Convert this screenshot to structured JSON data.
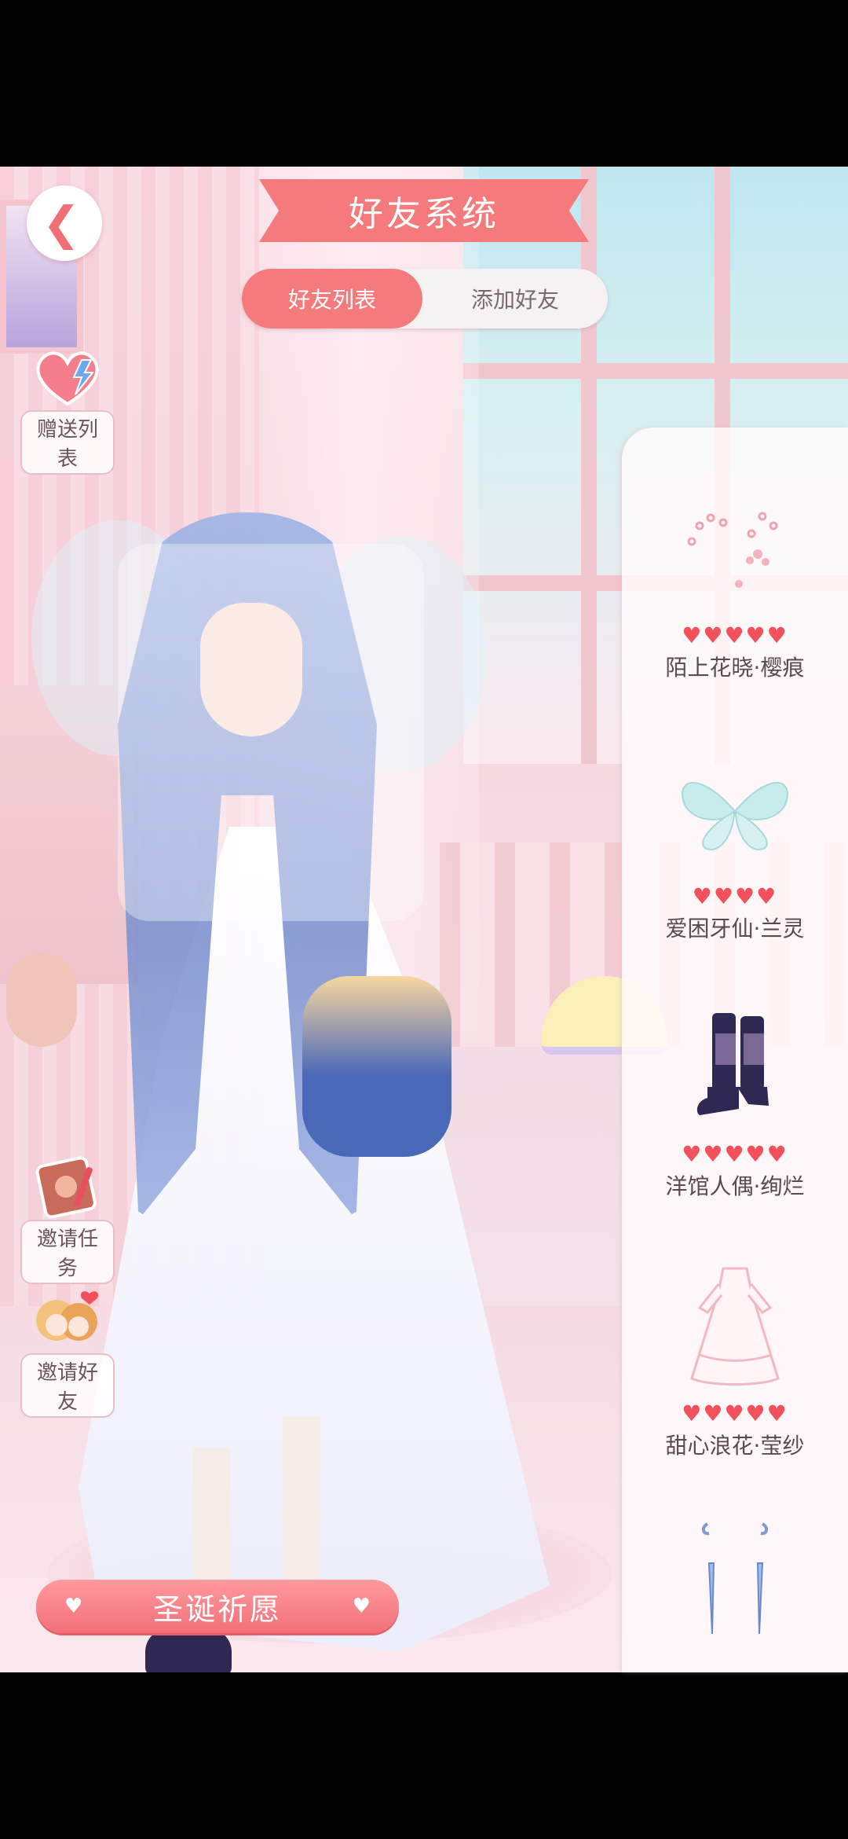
{
  "header": {
    "title": "好友系统",
    "back_icon": "chevron-left-icon"
  },
  "tabs": [
    {
      "label": "好友列表",
      "active": true
    },
    {
      "label": "添加好友",
      "active": false
    }
  ],
  "side_buttons": {
    "gift_list": {
      "label": "赠送列表",
      "icon": "heart-lightning-icon"
    },
    "invite_task": {
      "label": "邀请任务",
      "icon": "notebook-icon"
    },
    "invite_friend": {
      "label": "邀请好友",
      "icon": "two-girls-icon"
    }
  },
  "outfit_items": [
    {
      "name": "陌上花晓·樱痕",
      "hearts": "♥♥♥♥♥",
      "icon": "flower-hairpin-icon"
    },
    {
      "name": "爱困牙仙·兰灵",
      "hearts": "♥♥♥♥",
      "icon": "fairy-wings-icon"
    },
    {
      "name": "洋馆人偶·绚烂",
      "hearts": "♥♥♥♥♥",
      "icon": "boots-icon"
    },
    {
      "name": "甜心浪花·莹纱",
      "hearts": "♥♥♥♥♥",
      "icon": "dress-icon"
    },
    {
      "name": "",
      "hearts": "",
      "icon": "earrings-icon"
    }
  ],
  "wish_button": {
    "label": "圣诞祈愿",
    "left_icon": "♥",
    "right_icon": "♥"
  },
  "colors": {
    "accent": "#f47a7c",
    "heart": "#f2505a",
    "boots": "#2e2852"
  }
}
